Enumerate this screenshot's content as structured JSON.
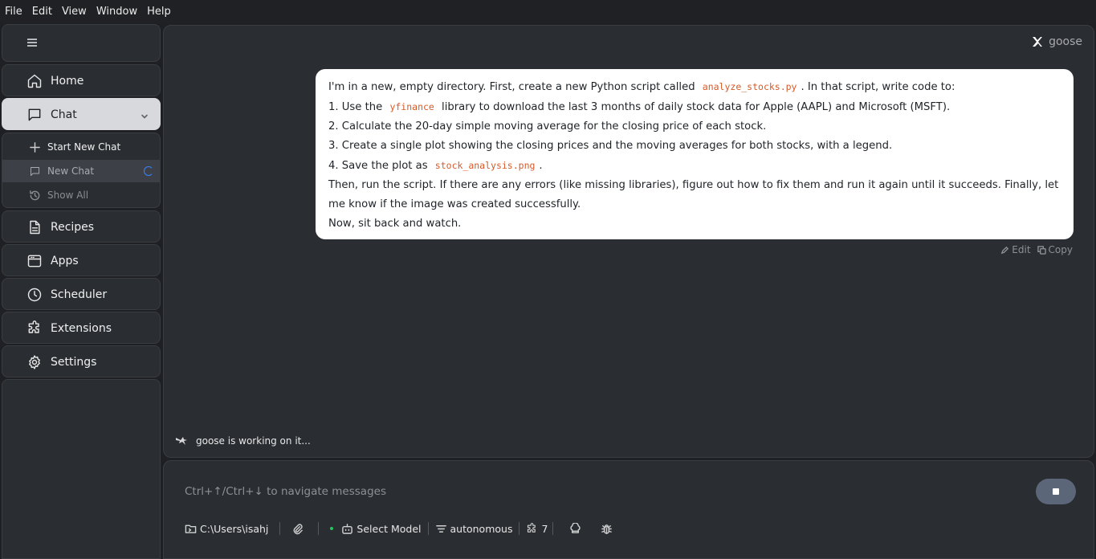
{
  "menu": [
    "File",
    "Edit",
    "View",
    "Window",
    "Help"
  ],
  "sidebar": {
    "toggle_icon": "menu-icon",
    "home": "Home",
    "chat": "Chat",
    "chat_sub": {
      "start_new": "Start New Chat",
      "current": "New Chat",
      "show_all": "Show All"
    },
    "recipes": "Recipes",
    "apps": "Apps",
    "scheduler": "Scheduler",
    "extensions": "Extensions",
    "settings": "Settings"
  },
  "brand": {
    "name": "goose"
  },
  "message": {
    "l1a": "I'm in a new, empty directory. First, create a new Python script called",
    "l1code": "analyze_stocks.py",
    "l1b": ". In that script, write code to:",
    "l2a": "1. Use the",
    "l2code": "yfinance",
    "l2b": "library to download the last 3 months of daily stock data for Apple (AAPL) and Microsoft (MSFT).",
    "l3": "2. Calculate the 20-day simple moving average for the closing price of each stock.",
    "l4": "3. Create a single plot showing the closing prices and the moving averages for both stocks, with a legend.",
    "l5a": "4. Save the plot as",
    "l5code": "stock_analysis.png",
    "l5b": ".",
    "l6": "Then, run the script. If there are any errors (like missing libraries), figure out how to fix them and run it again until it succeeds. Finally, let me know if the image was created successfully.",
    "l7": "Now, sit back and watch."
  },
  "actions": {
    "edit": "Edit",
    "copy": "Copy"
  },
  "status": "goose is working on it...",
  "input": {
    "placeholder": "Ctrl+↑/Ctrl+↓ to navigate messages"
  },
  "toolbar": {
    "directory": "C:\\Users\\isahj",
    "model": "Select Model",
    "mode": "autonomous",
    "extensions_count": "7"
  },
  "colors": {
    "accent_code": "#d85a28",
    "stop_button": "#5b6778",
    "status_dot": "#22c55e"
  }
}
